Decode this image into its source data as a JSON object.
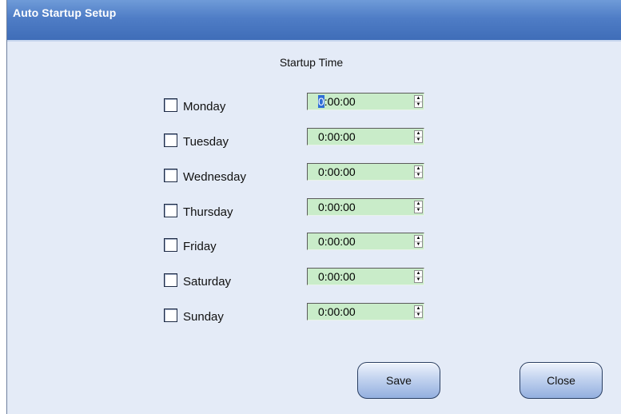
{
  "window": {
    "title": "Auto Startup Setup"
  },
  "section": {
    "title": "Startup Time"
  },
  "days": [
    {
      "label": "Monday",
      "time": "0:00:00",
      "checked": false
    },
    {
      "label": "Tuesday",
      "time": "0:00:00",
      "checked": false
    },
    {
      "label": "Wednesday",
      "time": "0:00:00",
      "checked": false
    },
    {
      "label": "Thursday",
      "time": "0:00:00",
      "checked": false
    },
    {
      "label": "Friday",
      "time": "0:00:00",
      "checked": false
    },
    {
      "label": "Saturday",
      "time": "0:00:00",
      "checked": false
    },
    {
      "label": "Sunday",
      "time": "0:00:00",
      "checked": false
    }
  ],
  "buttons": {
    "save": "Save",
    "close": "Close"
  },
  "colors": {
    "titlebar": "#4f7dc6",
    "background": "#e4ebf7",
    "time_field": "#c9ecc9",
    "selection": "#2f6ed6"
  }
}
